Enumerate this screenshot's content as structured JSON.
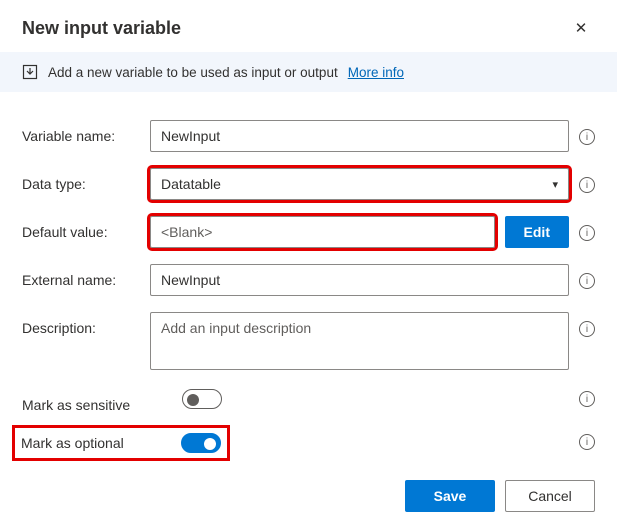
{
  "header": {
    "title": "New input variable"
  },
  "info_bar": {
    "text": "Add a new variable to be used as input or output",
    "link": "More info"
  },
  "fields": {
    "variable_name": {
      "label": "Variable name:",
      "value": "NewInput"
    },
    "data_type": {
      "label": "Data type:",
      "value": "Datatable"
    },
    "default_value": {
      "label": "Default value:",
      "value": "<Blank>",
      "edit": "Edit"
    },
    "external_name": {
      "label": "External name:",
      "value": "NewInput"
    },
    "description": {
      "label": "Description:",
      "placeholder": "Add an input description"
    },
    "mark_sensitive": {
      "label": "Mark as sensitive"
    },
    "mark_optional": {
      "label": "Mark as optional"
    }
  },
  "footer": {
    "save": "Save",
    "cancel": "Cancel"
  }
}
